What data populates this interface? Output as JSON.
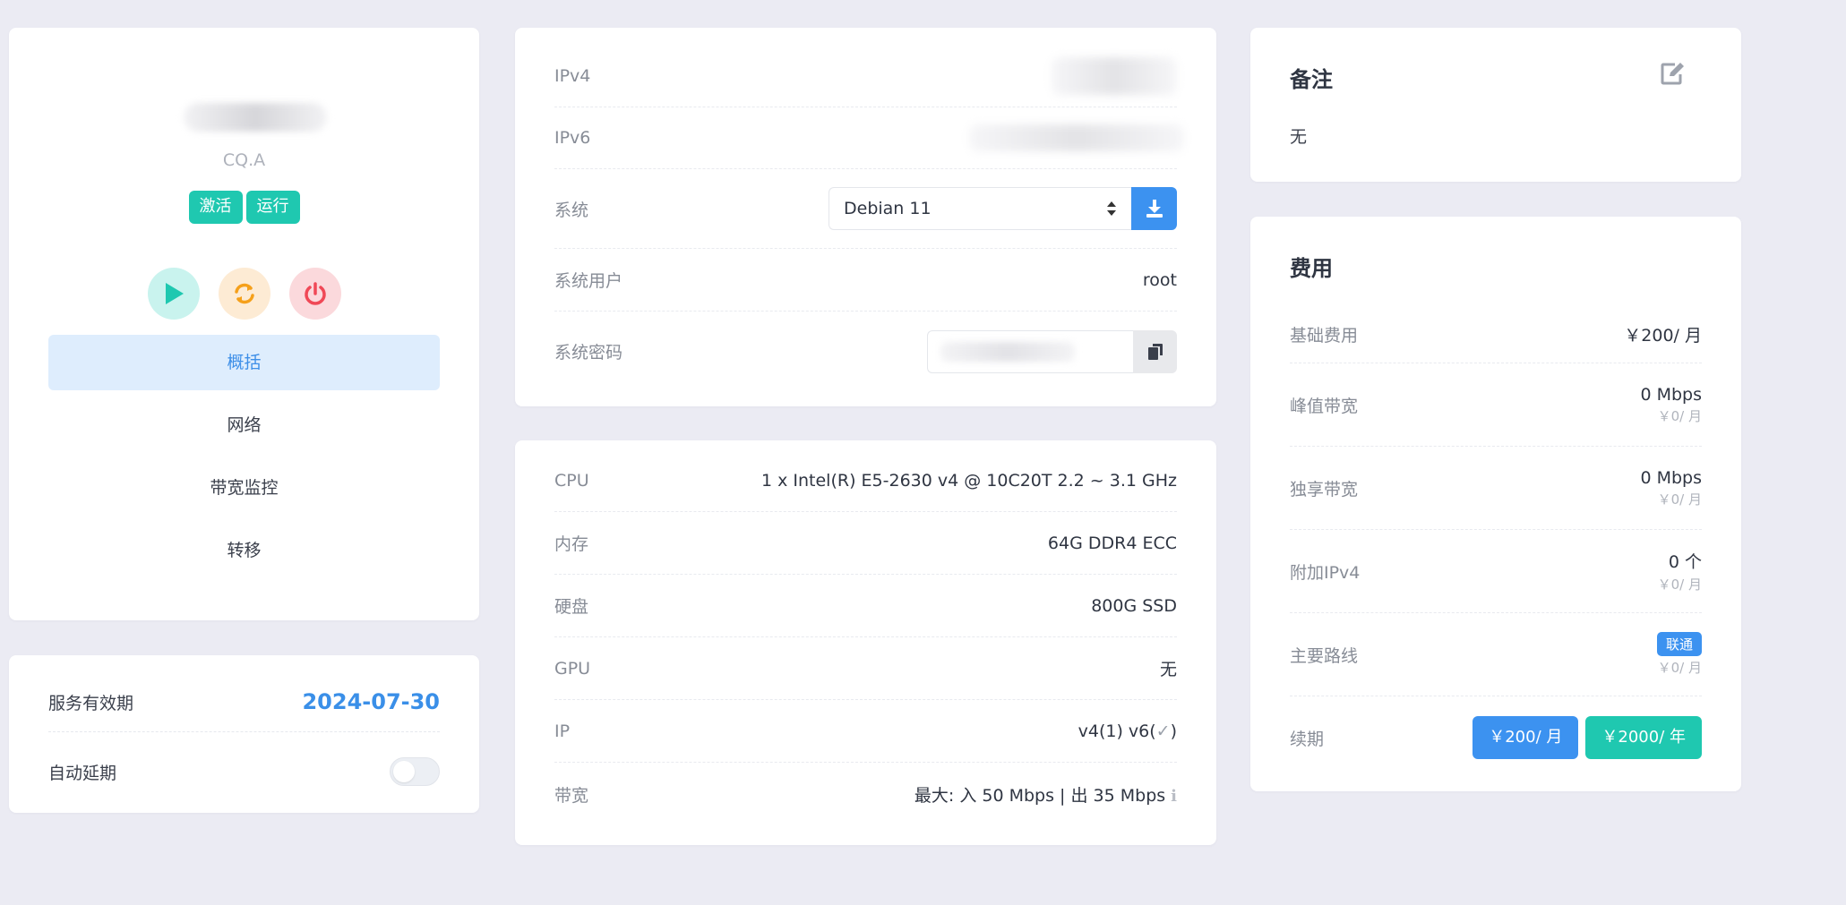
{
  "profile": {
    "location": "CQ.A",
    "badges": [
      "激活",
      "运行"
    ],
    "nav": [
      "概括",
      "网络",
      "带宽监控",
      "转移"
    ]
  },
  "validity": {
    "label": "服务有效期",
    "date": "2024-07-30",
    "auto_renew_label": "自动延期",
    "auto_renew_enabled": false
  },
  "system": {
    "ipv4_label": "IPv4",
    "ipv6_label": "IPv6",
    "os_label": "系统",
    "os_value": "Debian 11",
    "user_label": "系统用户",
    "user_value": "root",
    "password_label": "系统密码"
  },
  "hardware": {
    "rows": [
      {
        "label": "CPU",
        "value": "1 x Intel(R) E5-2630 v4 @ 10C20T 2.2 ~ 3.1 GHz"
      },
      {
        "label": "内存",
        "value": "64G DDR4 ECC"
      },
      {
        "label": "硬盘",
        "value": "800G SSD"
      },
      {
        "label": "GPU",
        "value": "无"
      },
      {
        "label": "IP",
        "value": "v4(1) v6("
      },
      {
        "label": "带宽",
        "value": "最大: 入 50 Mbps | 出 35 Mbps"
      }
    ],
    "ip_suffix": ")"
  },
  "notes": {
    "title": "备注",
    "content": "无"
  },
  "fees": {
    "title": "费用",
    "rows": [
      {
        "label": "基础费用",
        "main": "￥200/ 月",
        "sub": ""
      },
      {
        "label": "峰值带宽",
        "main": "0 Mbps",
        "sub": "￥0/ 月"
      },
      {
        "label": "独享带宽",
        "main": "0 Mbps",
        "sub": "￥0/ 月"
      },
      {
        "label": "附加IPv4",
        "main": "0 个",
        "sub": "￥0/ 月"
      },
      {
        "label": "主要路线",
        "tag": "联通",
        "sub": "￥0/ 月"
      }
    ],
    "renew_label": "续期",
    "renew_monthly": "￥200/ 月",
    "renew_yearly": "￥2000/ 年"
  },
  "colors": {
    "primary_blue": "#3c92f0",
    "teal": "#1fc8b0",
    "date_blue": "#3a8fe8"
  }
}
